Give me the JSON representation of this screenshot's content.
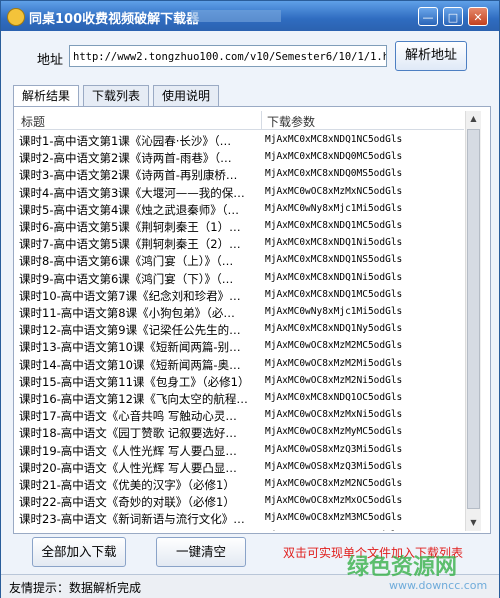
{
  "window": {
    "title": "同桌100收费视频破解下载器"
  },
  "address": {
    "label": "地址",
    "value": "http://www2.tongzhuo100.com/v10/Semester6/10/1/1.html",
    "parse_button": "解析地址"
  },
  "tabs": [
    {
      "label": "解析结果"
    },
    {
      "label": "下载列表"
    },
    {
      "label": "使用说明"
    }
  ],
  "list": {
    "headers": {
      "title": "标题",
      "params": "下载参数"
    },
    "rows": [
      {
        "title": "课时1-高中语文第1课《沁园春·长沙》（…",
        "param": "MjAxMC0xMC8xNDQ1NC5odGls"
      },
      {
        "title": "课时2-高中语文第2课《诗两首-雨巷》（…",
        "param": "MjAxMC0xMC8xNDQ0MC5odGls"
      },
      {
        "title": "课时3-高中语文第2课《诗两首-再别康桥…",
        "param": "MjAxMC0xMC8xNDQ0MS5odGls"
      },
      {
        "title": "课时4-高中语文第3课《大堰河——我的保…",
        "param": "MjAxMC0wOC8xMzMxNC5odGls"
      },
      {
        "title": "课时5-高中语文第4课《烛之武退秦师》（…",
        "param": "MjAxMC0wNy8xMjc1Mi5odGls"
      },
      {
        "title": "课时6-高中语文第5课《荆轲刺秦王（1）…",
        "param": "MjAxMC0xMC8xNDQ1MC5odGls"
      },
      {
        "title": "课时7-高中语文第5课《荆轲刺秦王（2）…",
        "param": "MjAxMC0xMC8xNDQ1Ni5odGls"
      },
      {
        "title": "课时8-高中语文第6课《鸿门宴（上）》（…",
        "param": "MjAxMC0xMC8xNDQ1NS5odGls"
      },
      {
        "title": "课时9-高中语文第6课《鸿门宴（下）》（…",
        "param": "MjAxMC0xMC8xNDQ1Ni5odGls"
      },
      {
        "title": "课时10-高中语文第7课《纪念刘和珍君》…",
        "param": "MjAxMC0xMC8xNDQ1MC5odGls"
      },
      {
        "title": "课时11-高中语文第8课《小狗包弟》（必…",
        "param": "MjAxMC0wNy8xMjc1Mi5odGls"
      },
      {
        "title": "课时12-高中语文第9课《记梁任公先生的…",
        "param": "MjAxMC0xMC8xNDQ1Ny5odGls"
      },
      {
        "title": "课时13-高中语文第10课《短新闻两篇-别…",
        "param": "MjAxMC0wOC8xMzM2MC5odGls"
      },
      {
        "title": "课时14-高中语文第10课《短新闻两篇-奥…",
        "param": "MjAxMC0wOC8xMzM2Mi5odGls"
      },
      {
        "title": "课时15-高中语文第11课《包身工》（必修1）",
        "param": "MjAxMC0wOC8xMzM2Ni5odGls"
      },
      {
        "title": "课时16-高中语文第12课《飞向太空的航程…",
        "param": "MjAxMC0xMC8xNDQ1OC5odGls"
      },
      {
        "title": "课时17-高中语文《心音共鸣 写触动心灵…",
        "param": "MjAxMC0wOC8xMzMxNi5odGls"
      },
      {
        "title": "课时18-高中语文《园丁赞歌 记叙要选好…",
        "param": "MjAxMC0wOC8xMzMyMC5odGls"
      },
      {
        "title": "课时19-高中语文《人性光辉 写人要凸显…",
        "param": "MjAxMC0wOS8xMzQ3Mi5odGls"
      },
      {
        "title": "课时20-高中语文《人性光辉 写人要凸显…",
        "param": "MjAxMC0wOS8xMzQ3Mi5odGls"
      },
      {
        "title": "课时21-高中语文《优美的汉字》（必修1）",
        "param": "MjAxMC0wOC8xMzM2NC5odGls"
      },
      {
        "title": "课时22-高中语文《奇妙的对联》（必修1）",
        "param": "MjAxMC0wOC8xMzMxOC5odGls"
      },
      {
        "title": "课时23-高中语文《新词新语与流行文化》…",
        "param": "MjAxMC0wOC8xMzM3MC5odGls"
      },
      {
        "title": "课时24-高中语文《第一单元复习》（必修1）",
        "param": "MjAxMS0xMS8yMTI2OC5odGls"
      },
      {
        "title": "课时25-高中语文《第一单元复习》（必修1）",
        "param": "MjAxMS0xMS8yMTI0OS5odGls"
      },
      {
        "title": "课时26-高中语文《第二单元复习》（必修1）",
        "param": "MjAxMS0xMS8yMTI3MC5odGls"
      }
    ]
  },
  "buttons": {
    "add_all": "全部加入下载",
    "clear": "一键清空"
  },
  "hint": "双击可实现单个文件加入下载列表",
  "status": "友情提示：数据解析完成",
  "watermark": {
    "brand": "绿色资源网",
    "url": "www.downcc.com"
  }
}
